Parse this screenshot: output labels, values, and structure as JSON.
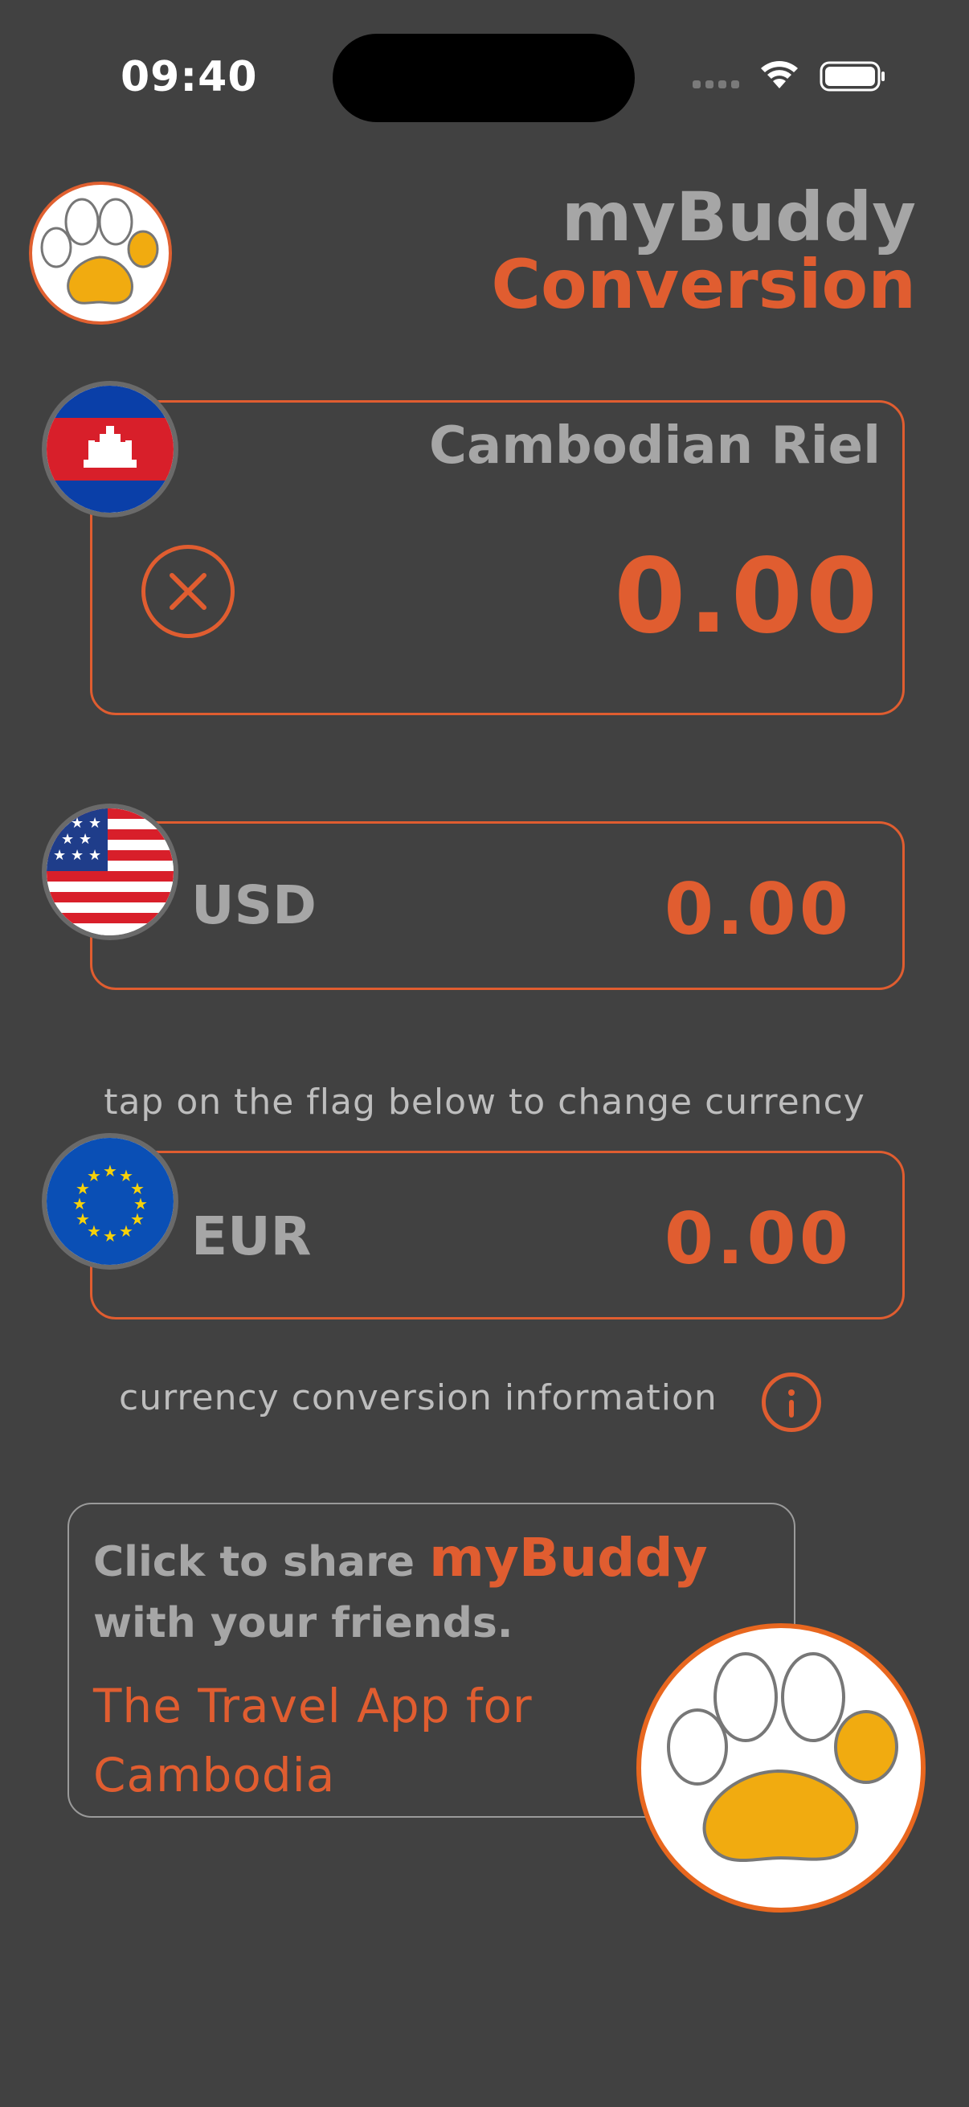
{
  "status_bar": {
    "time": "09:40"
  },
  "header": {
    "title_line1": "myBuddy",
    "title_line2": "Conversion",
    "logo_icon": "paw-logo-icon"
  },
  "main_currency": {
    "name": "Cambodian Riel",
    "value": "0.00",
    "flag_icon": "cambodia-flag-icon",
    "clear_icon": "clear-icon"
  },
  "usd": {
    "code": "USD",
    "value": "0.00",
    "flag_icon": "us-flag-icon"
  },
  "hint_text": "tap on the flag below to change currency",
  "eur": {
    "code": "EUR",
    "value": "0.00",
    "flag_icon": "eu-flag-icon"
  },
  "info": {
    "label": "currency conversion information",
    "icon": "info-icon"
  },
  "share": {
    "prefix": "Click to share ",
    "brand": "myBuddy",
    "line2": "with your friends.",
    "tagline": "The Travel App for Cambodia"
  },
  "colors": {
    "background": "#414141",
    "accent": "#e05d30",
    "text_muted": "#a6a6a6",
    "paw_fill": "#f1ab10"
  }
}
